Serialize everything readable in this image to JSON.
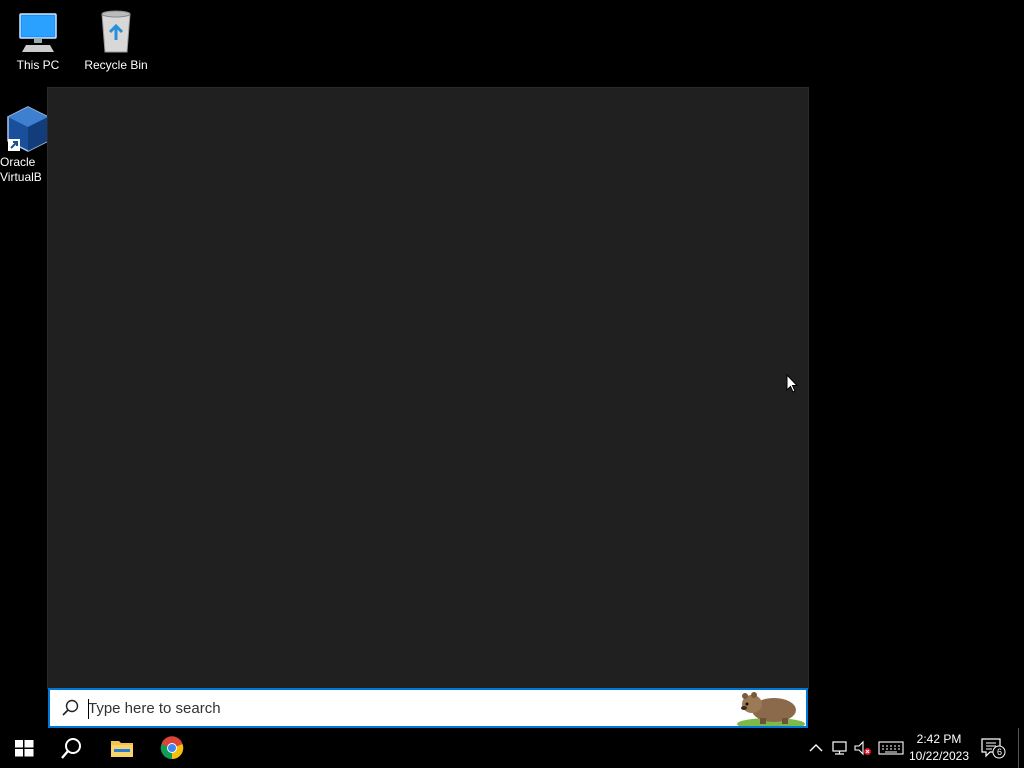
{
  "desktop": {
    "icons": [
      {
        "label": "This PC",
        "icon": "this-pc-icon"
      },
      {
        "label": "Recycle Bin",
        "icon": "recycle-bin-icon"
      },
      {
        "label": "Oracle VirtualB",
        "icon": "virtualbox-icon"
      }
    ]
  },
  "search": {
    "placeholder": "Type here to search"
  },
  "taskbar": {
    "pinned": [
      {
        "name": "start",
        "icon": "windows-logo-icon"
      },
      {
        "name": "search",
        "icon": "search-icon"
      },
      {
        "name": "file-explorer",
        "icon": "folder-icon"
      },
      {
        "name": "chrome",
        "icon": "chrome-icon"
      }
    ],
    "tray": {
      "time": "2:42 PM",
      "date": "10/22/2023",
      "notifications": "6"
    }
  },
  "colors": {
    "desktop_bg": "#000000",
    "panel_bg": "#202020",
    "accent": "#0078d7",
    "taskbar_bg": "#000000"
  }
}
